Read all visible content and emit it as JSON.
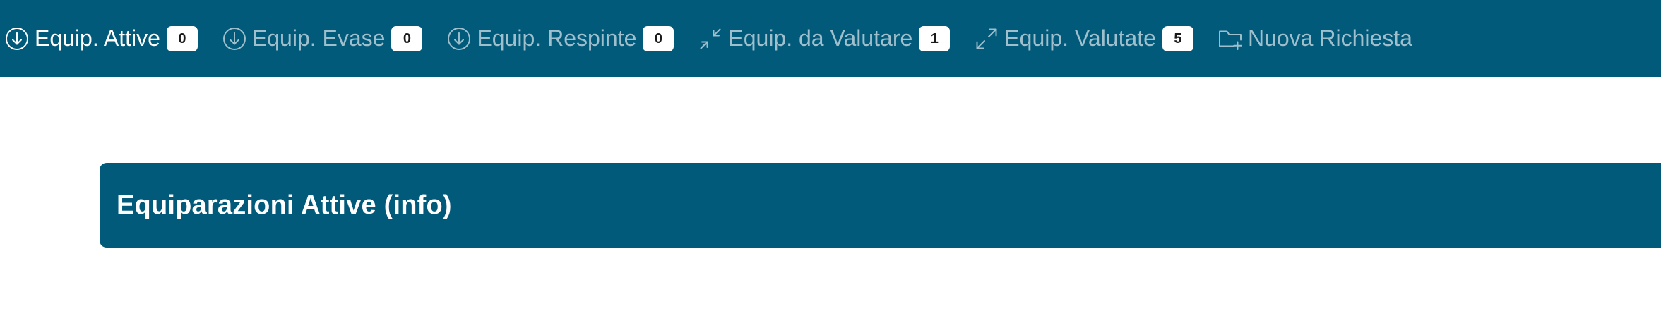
{
  "nav": {
    "items": [
      {
        "label": "Equip. Attive",
        "count": "0",
        "icon": "arrow-down-circle-icon"
      },
      {
        "label": "Equip. Evase",
        "count": "0",
        "icon": "arrow-down-circle-icon"
      },
      {
        "label": "Equip. Respinte",
        "count": "0",
        "icon": "arrow-down-circle-icon"
      },
      {
        "label": "Equip. da Valutare",
        "count": "1",
        "icon": "arrows-collapse-icon"
      },
      {
        "label": "Equip. Valutate",
        "count": "5",
        "icon": "arrows-expand-icon"
      },
      {
        "label": "Nuova Richiesta",
        "icon": "folder-plus-icon"
      }
    ],
    "active_index": 0
  },
  "panel": {
    "title": "Equiparazioni Attive (info)"
  },
  "colors": {
    "nav_bg": "#025a7b",
    "nav_text": "#9fbfcc",
    "active_text": "#ffffff",
    "badge_bg": "#ffffff"
  }
}
